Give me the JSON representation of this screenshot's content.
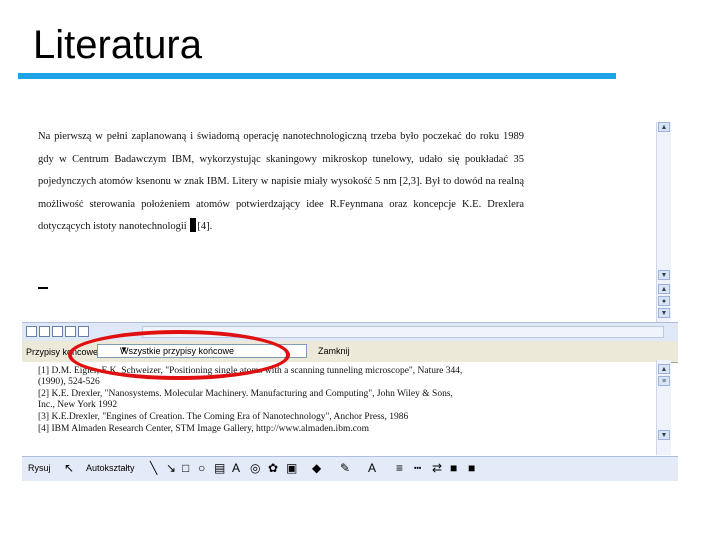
{
  "slide": {
    "title": "Literatura"
  },
  "document": {
    "paragraph": "Na pierwszą w pełni zaplanowaną i świadomą operację nanotechnologiczną trzeba było poczekać do roku 1989 gdy w Centrum Badawczym IBM, wykorzystując skaningowy mikroskop tunelowy, udało się poukładać 35 pojedynczych atomów ksenonu w znak IBM. Litery w napisie miały wysokość 5 nm [2,3]. Był to dowód na realną możliwość sterowania położeniem atomów potwierdzający idee R.Feynmana oraz koncepcje K.E. Drexlera dotyczących istoty nanotechnologii",
    "note_ref": "[4]."
  },
  "footnote_bar": {
    "label": "Przypisy końcowe",
    "select_value": "Wszystkie przypisy końcowe",
    "close_label": "Zamknij"
  },
  "notes": [
    "[1] D.M. Eigler, E.K. Schweizer, \"Positioning single atoms with a scanning tunneling microscope\", Nature 344,",
    "(1990), 524-526",
    "[2] K.E. Drexler, \"Nanosystems. Molecular Machinery. Manufacturing and Computing\", John Wiley & Sons,",
    "Inc., New York 1992",
    "[3] K.E.Drexler, \"Engines of Creation. The Coming Era of Nanotechnology\", Anchor Press, 1986",
    "[4] IBM Almaden Research Center, STM Image Gallery, http://www.almaden.ibm.com"
  ],
  "drawing_toolbar": {
    "draw_label": "Rysuj",
    "autoshapes_label": "Autokształty"
  },
  "colors": {
    "title_rule": "#1fa3e8",
    "highlight": "#e01010"
  }
}
